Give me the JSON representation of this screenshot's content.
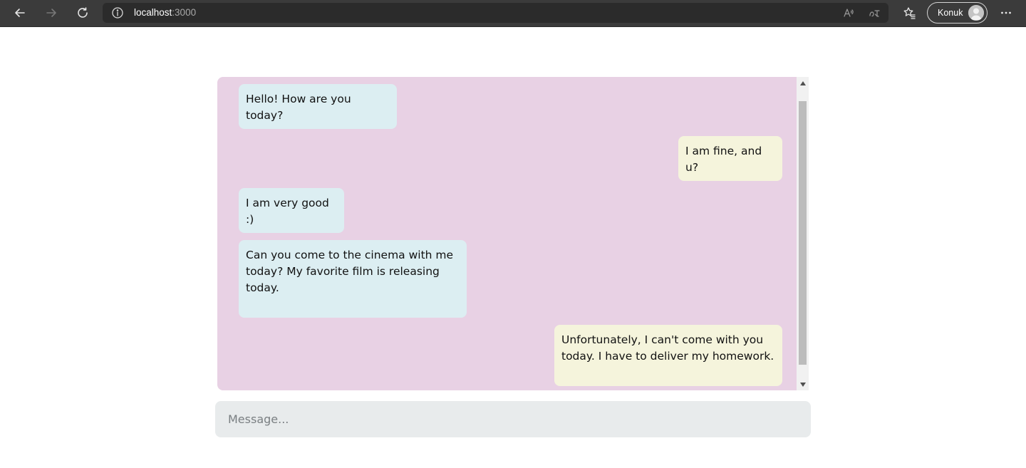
{
  "browser": {
    "url_host": "localhost",
    "url_port": ":3000",
    "profile_name": "Konuk",
    "icons": {
      "back": "back-arrow-icon",
      "forward": "forward-arrow-icon",
      "refresh": "refresh-icon",
      "site_info": "info-icon",
      "read_aloud": "read-aloud-icon",
      "translate": "translate-icon",
      "favorites": "favorites-icon",
      "more": "more-icon"
    }
  },
  "chat": {
    "colors": {
      "panel_background": "#e8d1e4",
      "incoming_bubble": "#dceef2",
      "outgoing_bubble": "#f5f4dc",
      "input_background": "#e8ebec"
    },
    "messages": [
      {
        "direction": "incoming",
        "text": "Hello! How are you today?"
      },
      {
        "direction": "outgoing",
        "text": "I am fine, and u?"
      },
      {
        "direction": "incoming",
        "text": "I am very good :)"
      },
      {
        "direction": "incoming",
        "text": "Can you come to the cinema with me today? My favorite film is releasing today."
      },
      {
        "direction": "outgoing",
        "text": "Unfortunately, I can't come with you today. I have to deliver my homework."
      }
    ],
    "input": {
      "placeholder": "Message...",
      "value": ""
    }
  }
}
